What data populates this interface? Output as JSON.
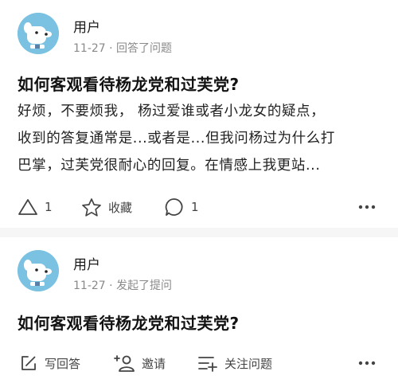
{
  "feed": [
    {
      "user": {
        "name": "用户"
      },
      "meta": {
        "date": "11-27",
        "separator": "·",
        "action": "回答了问题"
      },
      "question": "如何客观看待杨龙党和过芙党?",
      "excerpt": [
        "好烦，不要烦我， 杨过爱谁或者小龙女的疑点，",
        "收到的答复通常是...或者是...但我问杨过为什么打",
        "巴掌，过芙党很耐心的回复。在情感上我更站..."
      ],
      "actions": {
        "upvote_count": "1",
        "favorite_label": "收藏",
        "comment_count": "1"
      },
      "icons": [
        "upvote-icon",
        "star-icon",
        "comment-icon",
        "more-icon"
      ]
    },
    {
      "user": {
        "name": "用户"
      },
      "meta": {
        "date": "11-27",
        "separator": "·",
        "action": "发起了提问"
      },
      "question": "如何客观看待杨龙党和过芙党?",
      "actions": {
        "write_answer_label": "写回答",
        "invite_label": "邀请",
        "follow_label": "关注问题"
      },
      "icons": [
        "edit-icon",
        "add-user-icon",
        "follow-list-icon",
        "more-icon"
      ]
    }
  ],
  "colors": {
    "page_bg": "#f6f6f6",
    "card_bg": "#ffffff",
    "avatar_bg": "#7bc2e2",
    "meta_text": "#8a8a8a"
  }
}
